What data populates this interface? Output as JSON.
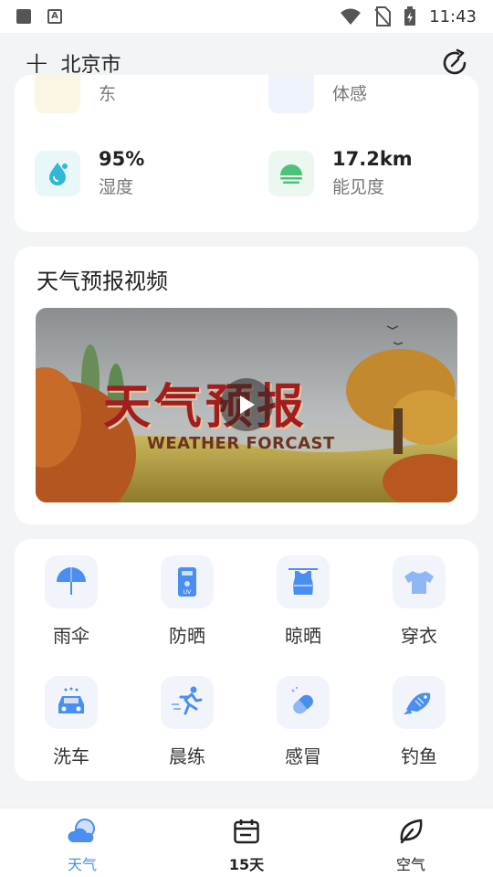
{
  "status_bar": {
    "time": "11:43"
  },
  "header": {
    "city": "北京市",
    "add_symbol": "+"
  },
  "metrics": {
    "partial_left_label": "东",
    "partial_right_label": "体感",
    "humidity": {
      "value": "95%",
      "label": "湿度"
    },
    "visibility": {
      "value": "17.2km",
      "label": "能见度"
    }
  },
  "video": {
    "section_title": "天气预报视频",
    "thumb_title_cn": "天气预报",
    "thumb_title_en": "WEATHER FORCAST"
  },
  "life_index": [
    {
      "label": "雨伞",
      "icon": "umbrella-icon"
    },
    {
      "label": "防晒",
      "icon": "sunscreen-icon"
    },
    {
      "label": "晾晒",
      "icon": "laundry-icon"
    },
    {
      "label": "穿衣",
      "icon": "clothes-icon"
    },
    {
      "label": "洗车",
      "icon": "car-wash-icon"
    },
    {
      "label": "晨练",
      "icon": "running-icon"
    },
    {
      "label": "感冒",
      "icon": "pill-icon"
    },
    {
      "label": "钓鱼",
      "icon": "fish-icon"
    }
  ],
  "bottom_nav": [
    {
      "label": "天气",
      "icon": "weather-cloud-icon",
      "active": true
    },
    {
      "label": "15天",
      "icon": "calendar-icon",
      "active": false
    },
    {
      "label": "空气",
      "icon": "leaf-icon",
      "active": false
    }
  ],
  "colors": {
    "accent": "#4a8ff0",
    "humidity_icon": "#2fb9d6",
    "visibility_icon": "#4cc27b"
  }
}
